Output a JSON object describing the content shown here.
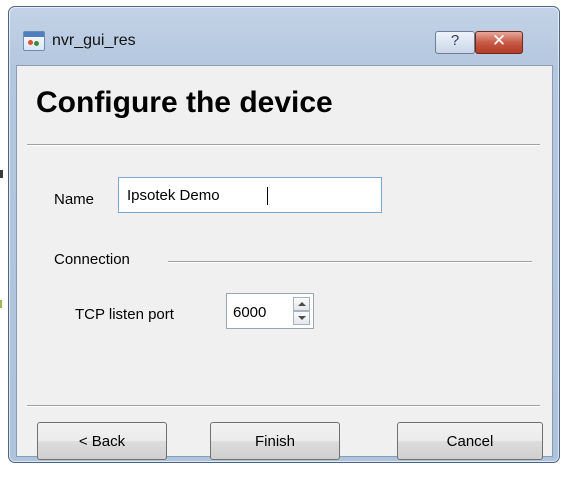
{
  "window": {
    "title": "nvr_gui_res",
    "help_glyph": "?",
    "close_glyph": "✕",
    "icons": [
      "app-icon",
      "help-icon",
      "close-icon"
    ]
  },
  "page": {
    "heading": "Configure the device"
  },
  "form": {
    "name_label": "Name",
    "name_value": "Ipsotek Demo",
    "connection_group": "Connection",
    "tcp_port_label": "TCP listen port",
    "tcp_port_value": "6000"
  },
  "buttons": {
    "back": "< Back",
    "finish": "Finish",
    "cancel": "Cancel"
  }
}
